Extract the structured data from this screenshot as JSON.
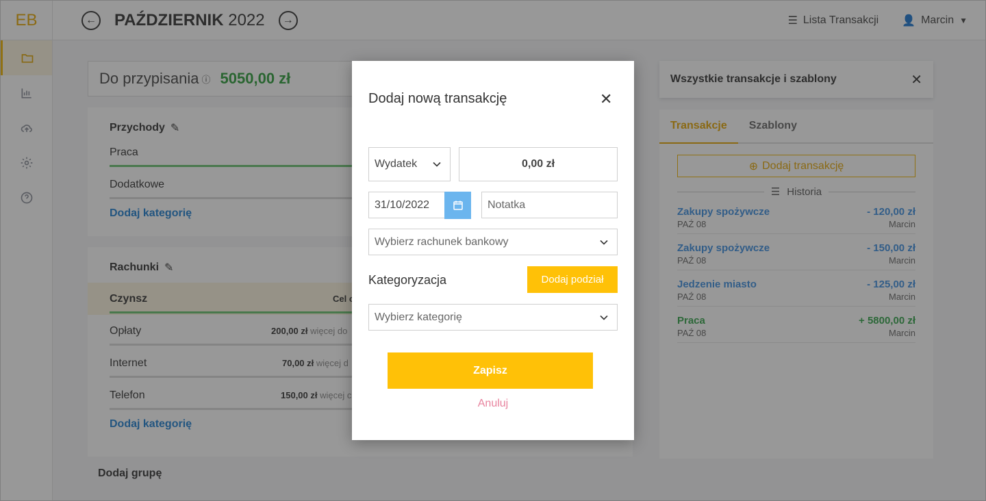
{
  "app": {
    "logo": "EB"
  },
  "sidebar": {
    "items": [
      {
        "icon": "folder-icon",
        "active": true
      },
      {
        "icon": "chart-bar-icon",
        "active": false
      },
      {
        "icon": "cloud-upload-icon",
        "active": false
      },
      {
        "icon": "gear-icon",
        "active": false
      },
      {
        "icon": "help-circle-icon",
        "active": false
      }
    ]
  },
  "header": {
    "month": "PAŹDZIERNIK",
    "year": "2022",
    "list_label": "Lista Transakcji",
    "user_name": "Marcin"
  },
  "assign": {
    "label": "Do przypisania",
    "amount": "5050,00 zł"
  },
  "groups": [
    {
      "title": "Przychody",
      "rows": [
        {
          "name": "Praca"
        },
        {
          "name": "Dodatkowe"
        }
      ],
      "add_label": "Dodaj kategorię"
    },
    {
      "title": "Rachunki",
      "rows": [
        {
          "name": "Czynsz",
          "meta": "Cel c"
        },
        {
          "name": "Opłaty",
          "meta_amount": "200,00 zł",
          "meta_text": "więcej do"
        },
        {
          "name": "Internet",
          "meta_amount": "70,00 zł",
          "meta_text": "więcej d"
        },
        {
          "name": "Telefon",
          "meta_amount": "150,00 zł",
          "meta_text": "więcej c"
        }
      ],
      "add_label": "Dodaj kategorię"
    }
  ],
  "add_group_label": "Dodaj grupę",
  "right_panel": {
    "title": "Wszystkie transakcje i szablony",
    "tabs": [
      "Transakcje",
      "Szablony"
    ],
    "add_button": "Dodaj transakcję",
    "history_label": "Historia",
    "transactions": [
      {
        "name": "Zakupy spożywcze",
        "amount": "- 120,00 zł",
        "date": "PAŹ 08",
        "user": "Marcin",
        "type": "expense"
      },
      {
        "name": "Zakupy spożywcze",
        "amount": "- 150,00 zł",
        "date": "PAŹ 08",
        "user": "Marcin",
        "type": "expense"
      },
      {
        "name": "Jedzenie miasto",
        "amount": "- 125,00 zł",
        "date": "PAŹ 08",
        "user": "Marcin",
        "type": "expense"
      },
      {
        "name": "Praca",
        "amount": "+ 5800,00 zł",
        "date": "PAŹ 08",
        "user": "Marcin",
        "type": "income"
      }
    ]
  },
  "modal": {
    "title": "Dodaj nową transakcję",
    "type_value": "Wydatek",
    "amount_value": "0,00 zł",
    "date_value": "31/10/2022",
    "note_placeholder": "Notatka",
    "account_placeholder": "Wybierz rachunek bankowy",
    "categorization_label": "Kategoryzacja",
    "split_button": "Dodaj podział",
    "category_placeholder": "Wybierz kategorię",
    "save_button": "Zapisz",
    "cancel_button": "Anuluj"
  },
  "colors": {
    "accent": "#ffc107",
    "income": "#2c9e3b",
    "link": "#1e7fd1",
    "overlay": "#282828"
  }
}
